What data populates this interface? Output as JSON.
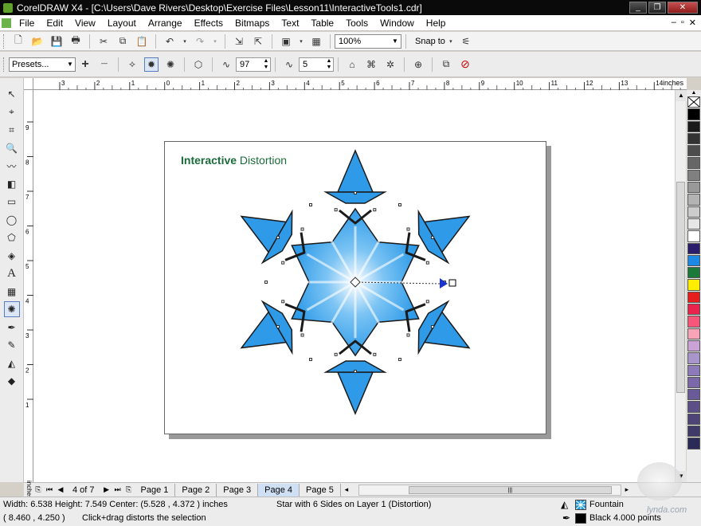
{
  "window": {
    "title": "CorelDRAW X4 - [C:\\Users\\Dave Rivers\\Desktop\\Exercise Files\\Lesson11\\InteractiveTools1.cdr]",
    "minimize": "_",
    "restore": "❐",
    "close": "✕"
  },
  "menu": {
    "items": [
      "File",
      "Edit",
      "View",
      "Layout",
      "Arrange",
      "Effects",
      "Bitmaps",
      "Text",
      "Table",
      "Tools",
      "Window",
      "Help"
    ]
  },
  "standard_toolbar": {
    "zoom_value": "100%",
    "snap_label": "Snap to"
  },
  "property_bar": {
    "presets_value": "Presets...",
    "amplitude_value": "97",
    "frequency_value": "5"
  },
  "ruler": {
    "units": "inches",
    "h_ticks": [
      "3",
      "2",
      "1",
      "0",
      "1",
      "2",
      "3",
      "4",
      "5",
      "6",
      "7",
      "8",
      "9",
      "10",
      "11",
      "12",
      "13",
      "14"
    ],
    "v_ticks": [
      "9",
      "8",
      "7",
      "6",
      "5",
      "4",
      "3",
      "2",
      "1"
    ]
  },
  "canvas": {
    "title_bold": "Interactive",
    "title_rest": " Distortion"
  },
  "page_nav": {
    "count": "4 of 7",
    "tabs": [
      "Page 1",
      "Page 2",
      "Page 3",
      "Page 4",
      "Page 5"
    ],
    "active_tab": "Page 4"
  },
  "status": {
    "dimensions": "Width: 6.538  Height: 7.549  Center: (5.528 , 4.372 )  inches",
    "object_info": "Star with 6 Sides on Layer 1 (Distortion)",
    "cursor": "( 8.460 , 4.250  )",
    "hint": "Click+drag distorts the selection",
    "fill_label": "Fountain",
    "outline_label": "Black  4.000 points",
    "watermark": "lynda.com"
  },
  "palette": {
    "colors": [
      "#000000",
      "#1a1a1a",
      "#333333",
      "#4d4d4d",
      "#666666",
      "#808080",
      "#999999",
      "#b3b3b3",
      "#cccccc",
      "#e6e6e6",
      "#ffffff",
      "#2b1d6b",
      "#1e88e5",
      "#1b7a3a",
      "#ffee00",
      "#e61e1e",
      "#e8244c",
      "#f5567a",
      "#f7a3b8",
      "#c9a2d6",
      "#a895c9",
      "#8c7bb8",
      "#7a68a8",
      "#6a5a98",
      "#5c4f88",
      "#4e4478",
      "#3f3a68",
      "#2c2b58"
    ]
  },
  "colors": {
    "accent_green": "#1a6b3a",
    "star_fill": "#2f9be8",
    "star_center": "#ffffff",
    "handle_blue": "#1a33cc"
  }
}
